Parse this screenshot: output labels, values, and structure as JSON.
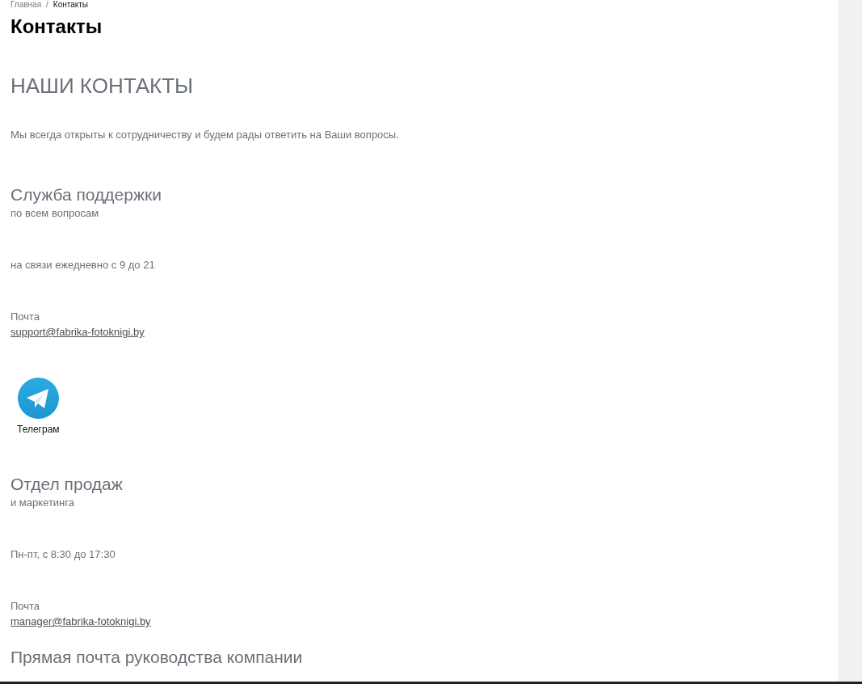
{
  "breadcrumb": [
    {
      "label": "Главная",
      "current": false
    },
    {
      "label": "/",
      "current": false
    },
    {
      "label": "Контакты",
      "current": true
    }
  ],
  "page_title": "Контакты",
  "heading": "НАШИ КОНТАКТЫ",
  "intro": "Мы всегда открыты к сотрудничеству и будем рады ответить на Ваши вопросы.",
  "sections": [
    {
      "title": "Служба поддержки",
      "subtitle": "по всем вопросам",
      "hours": "на связи ежедневно с 9 до 21",
      "email_label": "Почта",
      "email": "support@fabrika-fotoknigi.by",
      "messengers": [
        {
          "label": "Телеграм"
        }
      ]
    },
    {
      "title": "Отдел продаж",
      "subtitle": "и маркетинга",
      "hours": "Пн-пт, с 8:30 до 17:30",
      "email_label": "Почта",
      "email": "manager@fabrika-fotoknigi.by"
    },
    {
      "title": "Прямая почта руководства компании"
    }
  ]
}
